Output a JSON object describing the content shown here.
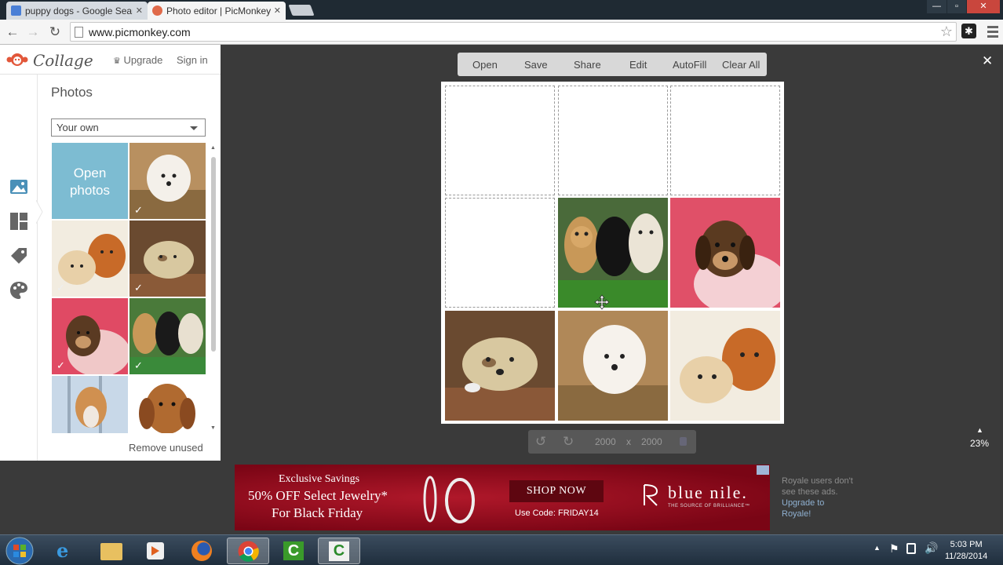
{
  "browser": {
    "tabs": [
      {
        "title": "puppy dogs - Google Sear",
        "close": "✕"
      },
      {
        "title": "Photo editor | PicMonkey",
        "close": "✕"
      }
    ],
    "url": "www.picmonkey.com",
    "window_controls": {
      "minimize": "—",
      "maximize": "▫",
      "close": "✕"
    },
    "extension_glyph": "✱"
  },
  "panel": {
    "app_name": "Collage",
    "upgrade_label": "Upgrade",
    "signin_label": "Sign in",
    "section_title": "Photos",
    "source_select": "Your own",
    "open_photos_label": "Open photos",
    "remove_unused_label": "Remove unused",
    "sidebar_icons": [
      "image-icon",
      "layout-icon",
      "tag-icon",
      "palette-icon"
    ],
    "thumbnails": [
      {
        "subject": "white fluffy puppy",
        "used": true
      },
      {
        "subject": "two puppies",
        "used": true
      },
      {
        "subject": "puppy in basket",
        "used": true
      },
      {
        "subject": "dachshund puppy",
        "used": true
      },
      {
        "subject": "three labrador puppies",
        "used": true
      },
      {
        "subject": "corgi puppy",
        "used": false
      },
      {
        "subject": "spaniel puppy",
        "used": false
      }
    ]
  },
  "editor": {
    "toolbar": [
      "Open",
      "Save",
      "Share",
      "Edit",
      "AutoFill",
      "Clear All"
    ],
    "close_label": "✕",
    "width": "2000",
    "height": "2000",
    "times": "x",
    "zoom": "23%",
    "cells": [
      {
        "state": "empty"
      },
      {
        "state": "empty"
      },
      {
        "state": "empty"
      },
      {
        "state": "empty"
      },
      {
        "state": "photo",
        "subject": "three labrador puppies"
      },
      {
        "state": "photo",
        "subject": "dachshund puppy"
      },
      {
        "state": "photo",
        "subject": "puppy in basket"
      },
      {
        "state": "photo",
        "subject": "white fluffy puppy"
      },
      {
        "state": "photo",
        "subject": "two puppies"
      }
    ]
  },
  "ad": {
    "line1": "Exclusive Savings",
    "line2": "50% OFF Select Jewelry*",
    "line3": "For Black Friday",
    "cta": "SHOP NOW",
    "code": "Use Code: FRIDAY14",
    "brand": "blue nile.",
    "tagline": "THE SOURCE OF BRILLIANCE™",
    "brand_color": "#9e1020"
  },
  "royale_note": {
    "text": "Royale users don't see these ads.",
    "link": "Upgrade to Royale!"
  },
  "taskbar": {
    "apps": [
      "start-orb",
      "internet-explorer",
      "file-explorer",
      "media-player",
      "firefox",
      "chrome",
      "camtasia-recorder",
      "camtasia-studio"
    ],
    "time": "5:03 PM",
    "date": "11/28/2014"
  }
}
